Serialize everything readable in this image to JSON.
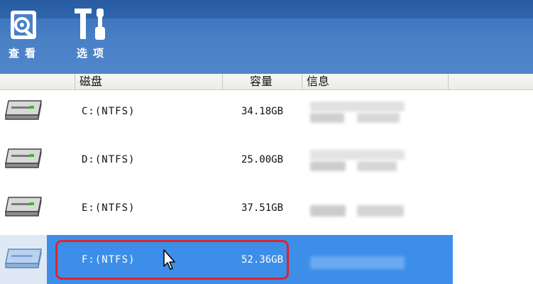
{
  "toolbar": {
    "buttons": [
      {
        "label": "查看",
        "icon": "disk-search-icon"
      },
      {
        "label": "选项",
        "icon": "tools-icon"
      }
    ]
  },
  "columns": {
    "icon": "",
    "disk": "磁盘",
    "capacity": "容量",
    "info": "信息"
  },
  "drives": [
    {
      "name": "C:(NTFS)",
      "capacity": "34.18GB",
      "selected": false
    },
    {
      "name": "D:(NTFS)",
      "capacity": "25.00GB",
      "selected": false
    },
    {
      "name": "E:(NTFS)",
      "capacity": "37.51GB",
      "selected": false
    },
    {
      "name": "F:(NTFS)",
      "capacity": "52.36GB",
      "selected": true
    }
  ],
  "colors": {
    "toolbar": "#4a80c6",
    "selection": "#3d8ee8",
    "highlight_outline": "#e0242b"
  }
}
